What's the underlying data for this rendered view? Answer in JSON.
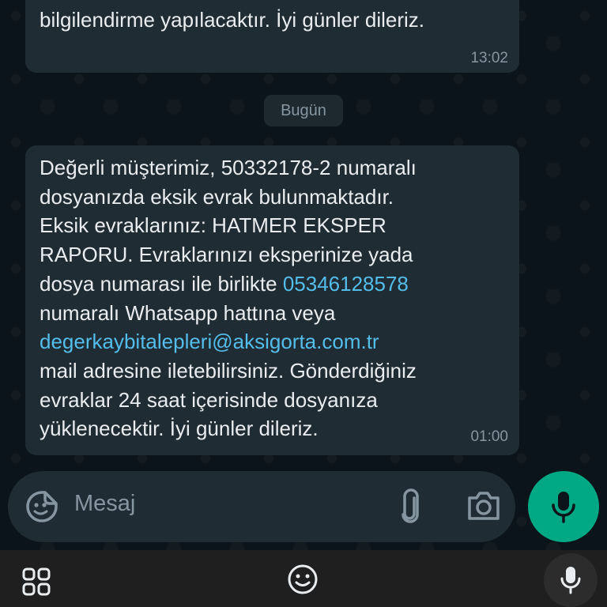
{
  "previous_message": {
    "text": "bilgilendirme yapılacaktır. İyi günler dileriz.",
    "time": "13:02"
  },
  "date_divider": "Bugün",
  "message": {
    "lines": [
      "Değerli müşterimiz, 50332178-2 numaralı",
      "dosyanızda eksik evrak bulunmaktadır.",
      "Eksik evraklarınız: HATMER EKSPER",
      "RAPORU. Evraklarınızı eksperinize yada"
    ],
    "line5_before_link": "dosya numarası ile birlikte ",
    "phone_link": "05346128578",
    "line6": "numaralı Whatsapp hattına veya",
    "email_link": "degerkaybitalepleri@aksigorta.com.tr",
    "lines_after": [
      "mail adresine iletebilirsiniz. Gönderdiğiniz",
      "evraklar 24 saat içerisinde dosyanıza",
      "yüklenecektir. İyi günler dileriz."
    ],
    "time": "01:00"
  },
  "composer": {
    "placeholder": "Mesaj",
    "icons": [
      "sticker-icon",
      "attach-icon",
      "camera-icon",
      "mic-icon"
    ]
  },
  "keyboard_bar": {
    "icons": [
      "grid-icon",
      "emoji-icon",
      "mic-icon"
    ]
  },
  "colors": {
    "background": "#0b141a",
    "bubble": "#202c33",
    "text": "#e9edef",
    "meta": "#8696a0",
    "link": "#53bdeb",
    "accent": "#00a884"
  }
}
